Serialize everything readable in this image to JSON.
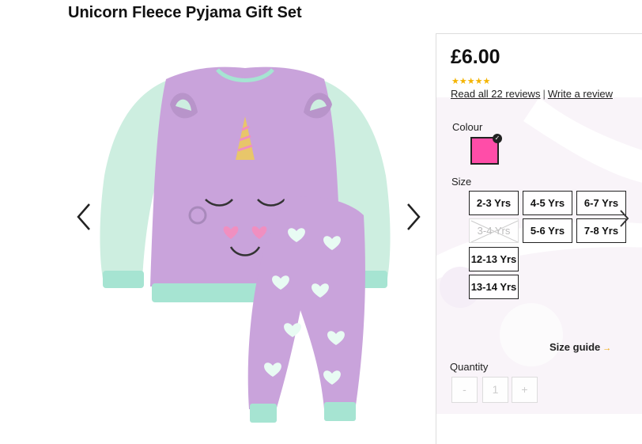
{
  "product": {
    "title": "Unicorn Fleece Pyjama Gift Set"
  },
  "gallery": {
    "prev_icon": "chevron-left-icon",
    "next_icon": "chevron-right-icon",
    "image_alt": "unicorn fleece pyjamas"
  },
  "panel": {
    "price": "£6.00",
    "rating_stars": "★★★★★",
    "rating_value": 4.5,
    "reviews_link": "Read all 22 reviews",
    "separator": "|",
    "write_review": "Write a review",
    "colour_label": "Colour",
    "selected_colour": "#ff4da8",
    "size_label": "Size",
    "sizes": [
      {
        "label": "2-3 Yrs",
        "available": true
      },
      {
        "label": "4-5 Yrs",
        "available": true
      },
      {
        "label": "6-7 Yrs",
        "available": true
      },
      {
        "label": "3-4 Yrs",
        "available": false
      },
      {
        "label": "5-6 Yrs",
        "available": true
      },
      {
        "label": "7-8 Yrs",
        "available": true
      },
      {
        "label": "12-13 Yrs",
        "available": true
      },
      {
        "label": "13-14 Yrs",
        "available": true
      }
    ],
    "size_guide": "Size guide",
    "size_guide_arrow": "→",
    "quantity_label": "Quantity",
    "qty_minus": "-",
    "qty_value": "1",
    "qty_plus": "+"
  },
  "colors": {
    "accent_star": "#f4b400",
    "pyjama_lilac": "#c9a3db",
    "pyjama_mint": "#cdeee0"
  }
}
